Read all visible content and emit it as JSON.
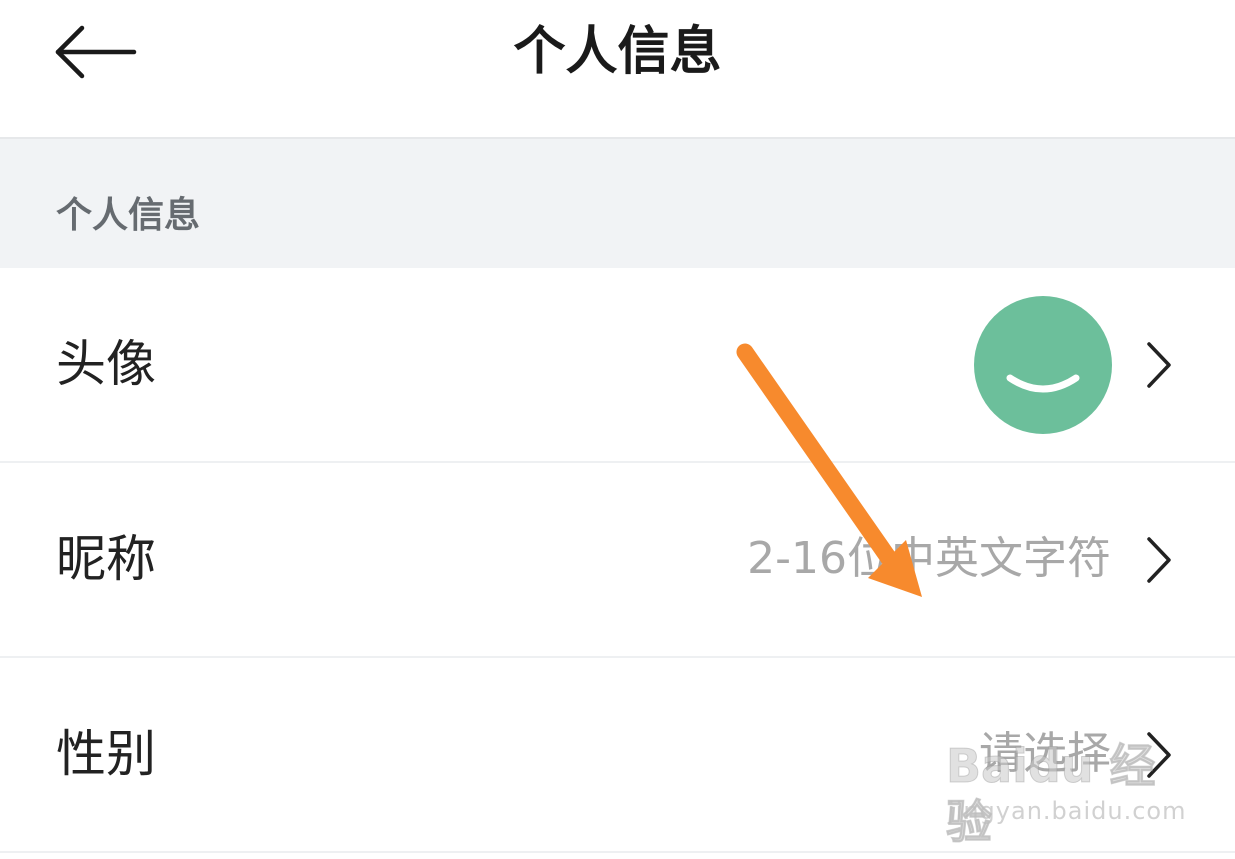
{
  "header": {
    "title": "个人信息",
    "back_icon": "arrow-left-icon"
  },
  "section": {
    "title": "个人信息"
  },
  "rows": [
    {
      "label": "头像",
      "value": "",
      "icon": "avatar-smile-icon",
      "avatar_color": "#6cbf9b"
    },
    {
      "label": "昵称",
      "value": "2-16位中英文字符"
    },
    {
      "label": "性别",
      "value": "请选择"
    }
  ],
  "annotation": {
    "icon": "orange-arrow-icon",
    "color": "#f78a2d"
  },
  "watermark": {
    "brand": "Baidu 经验",
    "url": "jingyan.baidu.com"
  },
  "colors": {
    "section_bg": "#f1f3f5",
    "divider": "#eef0f2"
  }
}
